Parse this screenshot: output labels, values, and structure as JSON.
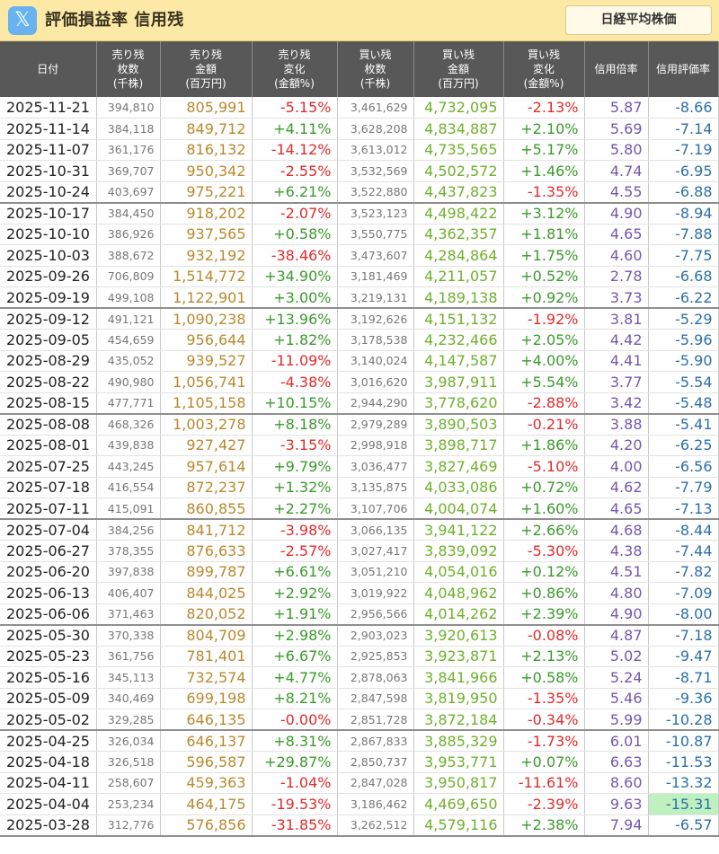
{
  "header": {
    "logo_glyph": "𝕏",
    "title": "評価損益率 信用残",
    "nikkei_button": "日経平均株価"
  },
  "columns": [
    [
      "日付"
    ],
    [
      "売り残",
      "枚数",
      "(千株)"
    ],
    [
      "売り残",
      "金額",
      "(百万円)"
    ],
    [
      "売り残",
      "変化",
      "(金額%)"
    ],
    [
      "買い残",
      "枚数",
      "(千株)"
    ],
    [
      "買い残",
      "金額",
      "(百万円)"
    ],
    [
      "買い残",
      "変化",
      "(金額%)"
    ],
    [
      "信用倍率"
    ],
    [
      "信用評価率"
    ]
  ],
  "rows": [
    [
      "2025-11-21",
      "394,810",
      "805,991",
      "-5.15%",
      "3,461,629",
      "4,732,095",
      "-2.13%",
      "5.87",
      "-8.66"
    ],
    [
      "2025-11-14",
      "384,118",
      "849,712",
      "+4.11%",
      "3,628,208",
      "4,834,887",
      "+2.10%",
      "5.69",
      "-7.14"
    ],
    [
      "2025-11-07",
      "361,176",
      "816,132",
      "-14.12%",
      "3,613,012",
      "4,735,565",
      "+5.17%",
      "5.80",
      "-7.19"
    ],
    [
      "2025-10-31",
      "369,707",
      "950,342",
      "-2.55%",
      "3,532,569",
      "4,502,572",
      "+1.46%",
      "4.74",
      "-6.95"
    ],
    [
      "2025-10-24",
      "403,697",
      "975,221",
      "+6.21%",
      "3,522,880",
      "4,437,823",
      "-1.35%",
      "4.55",
      "-6.88"
    ],
    [
      "2025-10-17",
      "384,450",
      "918,202",
      "-2.07%",
      "3,523,123",
      "4,498,422",
      "+3.12%",
      "4.90",
      "-8.94"
    ],
    [
      "2025-10-10",
      "386,926",
      "937,565",
      "+0.58%",
      "3,550,775",
      "4,362,357",
      "+1.81%",
      "4.65",
      "-7.88"
    ],
    [
      "2025-10-03",
      "388,672",
      "932,192",
      "-38.46%",
      "3,473,607",
      "4,284,864",
      "+1.75%",
      "4.60",
      "-7.75"
    ],
    [
      "2025-09-26",
      "706,809",
      "1,514,772",
      "+34.90%",
      "3,181,469",
      "4,211,057",
      "+0.52%",
      "2.78",
      "-6.68"
    ],
    [
      "2025-09-19",
      "499,108",
      "1,122,901",
      "+3.00%",
      "3,219,131",
      "4,189,138",
      "+0.92%",
      "3.73",
      "-6.22"
    ],
    [
      "2025-09-12",
      "491,121",
      "1,090,238",
      "+13.96%",
      "3,192,626",
      "4,151,132",
      "-1.92%",
      "3.81",
      "-5.29"
    ],
    [
      "2025-09-05",
      "454,659",
      "956,644",
      "+1.82%",
      "3,178,538",
      "4,232,466",
      "+2.05%",
      "4.42",
      "-5.96"
    ],
    [
      "2025-08-29",
      "435,052",
      "939,527",
      "-11.09%",
      "3,140,024",
      "4,147,587",
      "+4.00%",
      "4.41",
      "-5.90"
    ],
    [
      "2025-08-22",
      "490,980",
      "1,056,741",
      "-4.38%",
      "3,016,620",
      "3,987,911",
      "+5.54%",
      "3.77",
      "-5.54"
    ],
    [
      "2025-08-15",
      "477,771",
      "1,105,158",
      "+10.15%",
      "2,944,290",
      "3,778,620",
      "-2.88%",
      "3.42",
      "-5.48"
    ],
    [
      "2025-08-08",
      "468,326",
      "1,003,278",
      "+8.18%",
      "2,979,289",
      "3,890,503",
      "-0.21%",
      "3.88",
      "-5.41"
    ],
    [
      "2025-08-01",
      "439,838",
      "927,427",
      "-3.15%",
      "2,998,918",
      "3,898,717",
      "+1.86%",
      "4.20",
      "-6.25"
    ],
    [
      "2025-07-25",
      "443,245",
      "957,614",
      "+9.79%",
      "3,036,477",
      "3,827,469",
      "-5.10%",
      "4.00",
      "-6.56"
    ],
    [
      "2025-07-18",
      "416,554",
      "872,237",
      "+1.32%",
      "3,135,875",
      "4,033,086",
      "+0.72%",
      "4.62",
      "-7.79"
    ],
    [
      "2025-07-11",
      "415,091",
      "860,855",
      "+2.27%",
      "3,107,706",
      "4,004,074",
      "+1.60%",
      "4.65",
      "-7.13"
    ],
    [
      "2025-07-04",
      "384,256",
      "841,712",
      "-3.98%",
      "3,066,135",
      "3,941,122",
      "+2.66%",
      "4.68",
      "-8.44"
    ],
    [
      "2025-06-27",
      "378,355",
      "876,633",
      "-2.57%",
      "3,027,417",
      "3,839,092",
      "-5.30%",
      "4.38",
      "-7.44"
    ],
    [
      "2025-06-20",
      "397,838",
      "899,787",
      "+6.61%",
      "3,051,210",
      "4,054,016",
      "+0.12%",
      "4.51",
      "-7.82"
    ],
    [
      "2025-06-13",
      "406,407",
      "844,025",
      "+2.92%",
      "3,019,922",
      "4,048,962",
      "+0.86%",
      "4.80",
      "-7.09"
    ],
    [
      "2025-06-06",
      "371,463",
      "820,052",
      "+1.91%",
      "2,956,566",
      "4,014,262",
      "+2.39%",
      "4.90",
      "-8.00"
    ],
    [
      "2025-05-30",
      "370,338",
      "804,709",
      "+2.98%",
      "2,903,023",
      "3,920,613",
      "-0.08%",
      "4.87",
      "-7.18"
    ],
    [
      "2025-05-23",
      "361,756",
      "781,401",
      "+6.67%",
      "2,925,853",
      "3,923,871",
      "+2.13%",
      "5.02",
      "-9.47"
    ],
    [
      "2025-05-16",
      "345,113",
      "732,574",
      "+4.77%",
      "2,878,063",
      "3,841,966",
      "+0.58%",
      "5.24",
      "-8.71"
    ],
    [
      "2025-05-09",
      "340,469",
      "699,198",
      "+8.21%",
      "2,847,598",
      "3,819,950",
      "-1.35%",
      "5.46",
      "-9.36"
    ],
    [
      "2025-05-02",
      "329,285",
      "646,135",
      "-0.00%",
      "2,851,728",
      "3,872,184",
      "-0.34%",
      "5.99",
      "-10.28"
    ],
    [
      "2025-04-25",
      "326,034",
      "646,137",
      "+8.31%",
      "2,867,833",
      "3,885,329",
      "-1.73%",
      "6.01",
      "-10.87"
    ],
    [
      "2025-04-18",
      "326,518",
      "596,587",
      "+29.87%",
      "2,850,737",
      "3,953,771",
      "+0.07%",
      "6.63",
      "-11.53"
    ],
    [
      "2025-04-11",
      "258,607",
      "459,363",
      "-1.04%",
      "2,847,028",
      "3,950,817",
      "-11.61%",
      "8.60",
      "-13.32"
    ],
    [
      "2025-04-04",
      "253,234",
      "464,175",
      "-19.53%",
      "3,186,462",
      "4,469,650",
      "-2.39%",
      "9.63",
      "-15.31"
    ],
    [
      "2025-03-28",
      "312,776",
      "576,856",
      "-31.85%",
      "3,262,512",
      "4,579,116",
      "+2.38%",
      "7.94",
      "-6.57"
    ]
  ],
  "highlight": {
    "row": 33,
    "col": 8,
    "color": "#bff0bf"
  }
}
